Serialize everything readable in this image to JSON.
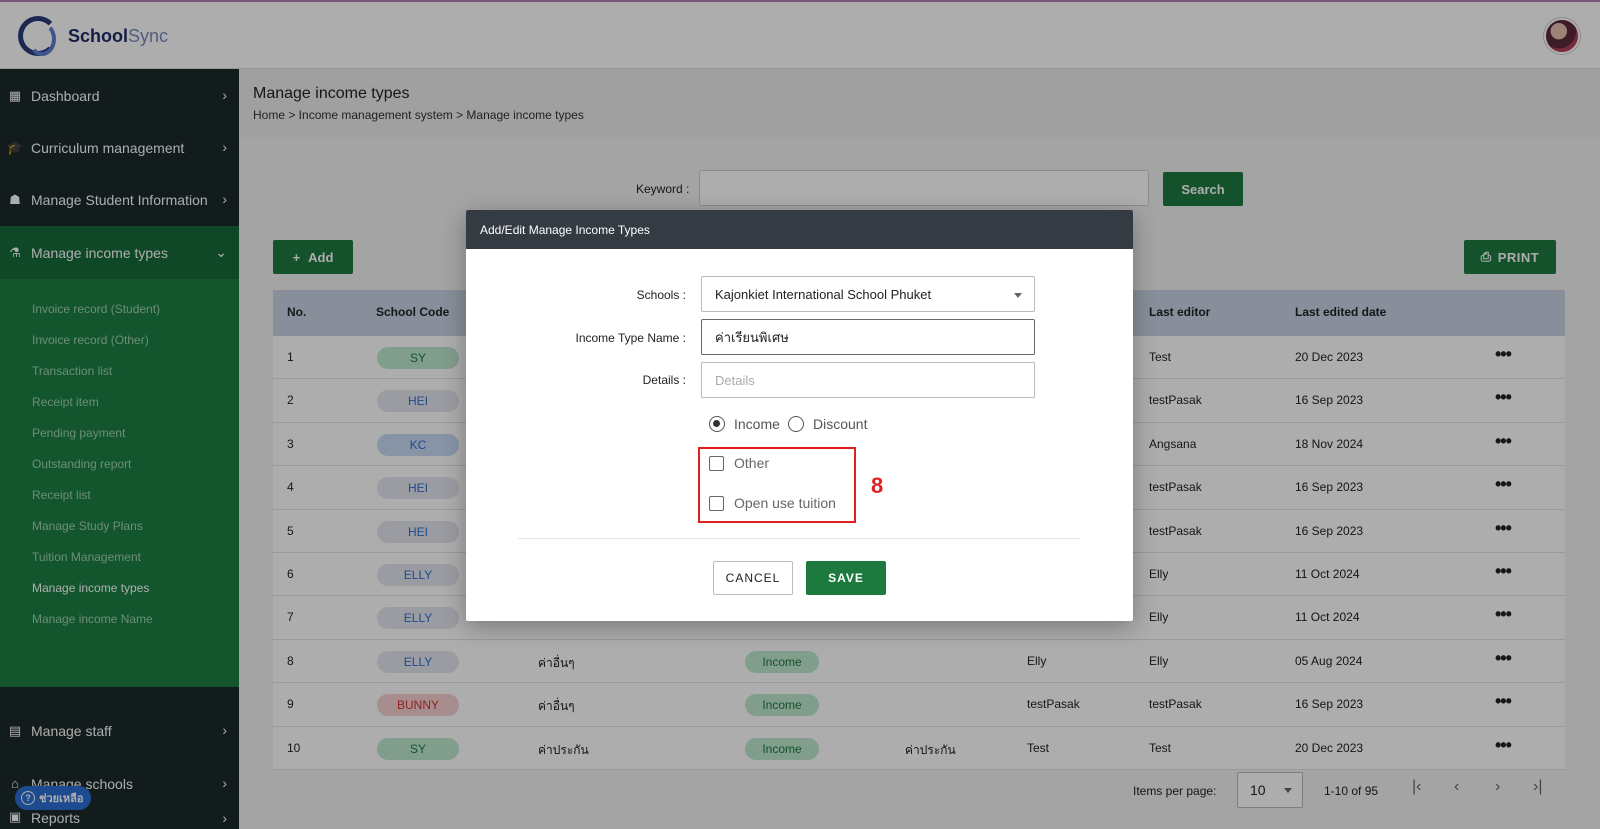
{
  "app": {
    "brand_a": "School",
    "brand_b": "Sync"
  },
  "sidebar": {
    "items": [
      {
        "label": "Dashboard",
        "icon": "grid-icon"
      },
      {
        "label": "Curriculum management",
        "icon": "graduation-cap-icon"
      },
      {
        "label": "Manage Student Information",
        "icon": "student-icon"
      },
      {
        "label": "Manage income types",
        "icon": "flask-icon"
      },
      {
        "label": "Manage staff",
        "icon": "id-card-icon"
      },
      {
        "label": "Manage schools",
        "icon": "school-icon"
      },
      {
        "label": "Reports",
        "icon": "report-icon"
      }
    ],
    "sub_items": [
      "Invoice record (Student)",
      "Invoice record (Other)",
      "Transaction list",
      "Receipt item",
      "Pending payment",
      "Outstanding report",
      "Receipt list",
      "Manage Study Plans",
      "Tuition Management",
      "Manage income types",
      "Manage income Name"
    ],
    "help_label": "ช่วยเหลือ"
  },
  "main": {
    "title": "Manage income types",
    "breadcrumb": "Home > Income management system > Manage income types",
    "keyword_label": "Keyword :",
    "search_label": "Search",
    "add_label": "Add",
    "print_label": "PRINT"
  },
  "table": {
    "headers": {
      "no": "No.",
      "school_code": "School Code",
      "last_editor": "Last editor",
      "last_edited_date": "Last edited date"
    },
    "rows": [
      {
        "no": "1",
        "code": "SY",
        "code_color": "#bfe8cf",
        "code_text": "#1d7a3e",
        "name": "",
        "type": "",
        "detail": "",
        "creator": "",
        "editor": "Test",
        "date": "20 Dec 2023"
      },
      {
        "no": "2",
        "code": "HEI",
        "code_color": "#e3e6ee",
        "code_text": "#2c6fd6",
        "name": "",
        "type": "",
        "detail": "",
        "creator": "",
        "editor": "testPasak",
        "date": "16 Sep 2023"
      },
      {
        "no": "3",
        "code": "KC",
        "code_color": "#c6daf5",
        "code_text": "#2c6fd6",
        "name": "",
        "type": "",
        "detail": "",
        "creator": "",
        "editor": "Angsana",
        "date": "18 Nov 2024"
      },
      {
        "no": "4",
        "code": "HEI",
        "code_color": "#e3e6ee",
        "code_text": "#2c6fd6",
        "name": "",
        "type": "",
        "detail": "",
        "creator": "",
        "editor": "testPasak",
        "date": "16 Sep 2023"
      },
      {
        "no": "5",
        "code": "HEI",
        "code_color": "#e3e6ee",
        "code_text": "#2c6fd6",
        "name": "",
        "type": "",
        "detail": "",
        "creator": "",
        "editor": "testPasak",
        "date": "16 Sep 2023"
      },
      {
        "no": "6",
        "code": "ELLY",
        "code_color": "#e3e6ee",
        "code_text": "#2c6fd6",
        "name": "",
        "type": "",
        "detail": "",
        "creator": "",
        "editor": "Elly",
        "date": "11 Oct 2024"
      },
      {
        "no": "7",
        "code": "ELLY",
        "code_color": "#e3e6ee",
        "code_text": "#2c6fd6",
        "name": "",
        "type": "",
        "detail": "",
        "creator": "",
        "editor": "Elly",
        "date": "11 Oct 2024"
      },
      {
        "no": "8",
        "code": "ELLY",
        "code_color": "#e3e6ee",
        "code_text": "#2c6fd6",
        "name": "ค่าอื่นๆ",
        "type": "Income",
        "detail": "",
        "creator": "Elly",
        "editor": "Elly",
        "date": "05 Aug 2024"
      },
      {
        "no": "9",
        "code": "BUNNY",
        "code_color": "#f7d0d0",
        "code_text": "#d83030",
        "name": "ค่าอื่นๆ",
        "type": "Income",
        "detail": "",
        "creator": "testPasak",
        "editor": "testPasak",
        "date": "16 Sep 2023"
      },
      {
        "no": "10",
        "code": "SY",
        "code_color": "#bfe8cf",
        "code_text": "#1d7a3e",
        "name": "ค่าประกัน",
        "type": "Income",
        "detail": "ค่าประกัน",
        "creator": "Test",
        "editor": "Test",
        "date": "20 Dec 2023"
      }
    ]
  },
  "pager": {
    "label": "Items per page:",
    "per_page": "10",
    "range": "1-10 of 95"
  },
  "modal": {
    "title": "Add/Edit Manage Income Types",
    "schools_label": "Schools :",
    "schools_value": "Kajonkiet International School Phuket",
    "name_label": "Income Type Name :",
    "name_value": "ค่าเรียนพิเศษ",
    "details_label": "Details :",
    "details_placeholder": "Details",
    "radio_income": "Income",
    "radio_discount": "Discount",
    "check_other": "Other",
    "check_open_tuition": "Open use tuition",
    "annotation": "8",
    "cancel_label": "CANCEL",
    "save_label": "SAVE"
  }
}
